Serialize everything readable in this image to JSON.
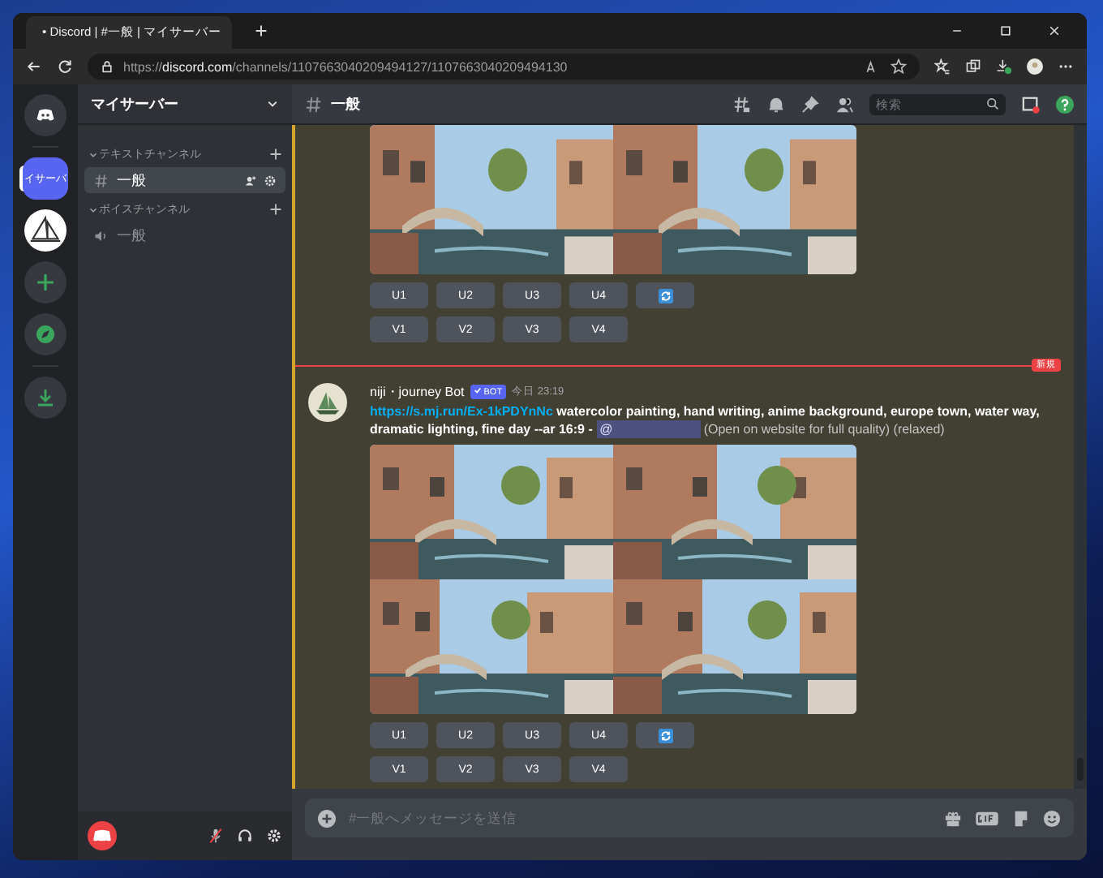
{
  "browser": {
    "tab_title": "• Discord | #一般 | マイサーバー",
    "url_scheme": "https://",
    "url_host": "discord.com",
    "url_path": "/channels/1107663040209494127/1107663040209494130"
  },
  "server_rail": [
    {
      "kind": "home",
      "selected": false
    },
    {
      "kind": "server",
      "label": "イサーバ",
      "selected": true
    },
    {
      "kind": "avatar",
      "selected": false
    },
    {
      "kind": "add",
      "selected": false
    },
    {
      "kind": "explore",
      "selected": false
    },
    {
      "kind": "download",
      "selected": false
    }
  ],
  "server": {
    "name": "マイサーバー"
  },
  "categories": [
    {
      "name": "テキストチャンネル",
      "channels": [
        {
          "name": "一般",
          "kind": "text",
          "selected": true
        }
      ]
    },
    {
      "name": "ボイスチャンネル",
      "channels": [
        {
          "name": "一般",
          "kind": "voice",
          "selected": false
        }
      ]
    }
  ],
  "header": {
    "channel": "一般",
    "search_placeholder": "検索"
  },
  "messages": [
    {
      "upscale": [
        "U1",
        "U2",
        "U3",
        "U4"
      ],
      "variation": [
        "V1",
        "V2",
        "V3",
        "V4"
      ]
    },
    {
      "author": "niji・journey Bot",
      "badge": "BOT",
      "time": "今日 23:19",
      "link": "https://s.mj.run/Ex-1kPDYnNc",
      "text": "watercolor painting, hand writing, anime background, europe town, water way, dramatic lighting, fine day --ar 16:9 -",
      "mention": "@",
      "note": "(Open on website for full quality) (relaxed)",
      "upscale": [
        "U1",
        "U2",
        "U3",
        "U4"
      ],
      "variation": [
        "V1",
        "V2",
        "V3",
        "V4"
      ]
    }
  ],
  "new_divider": "新規",
  "composer": {
    "placeholder": "#一般へメッセージを送信"
  }
}
